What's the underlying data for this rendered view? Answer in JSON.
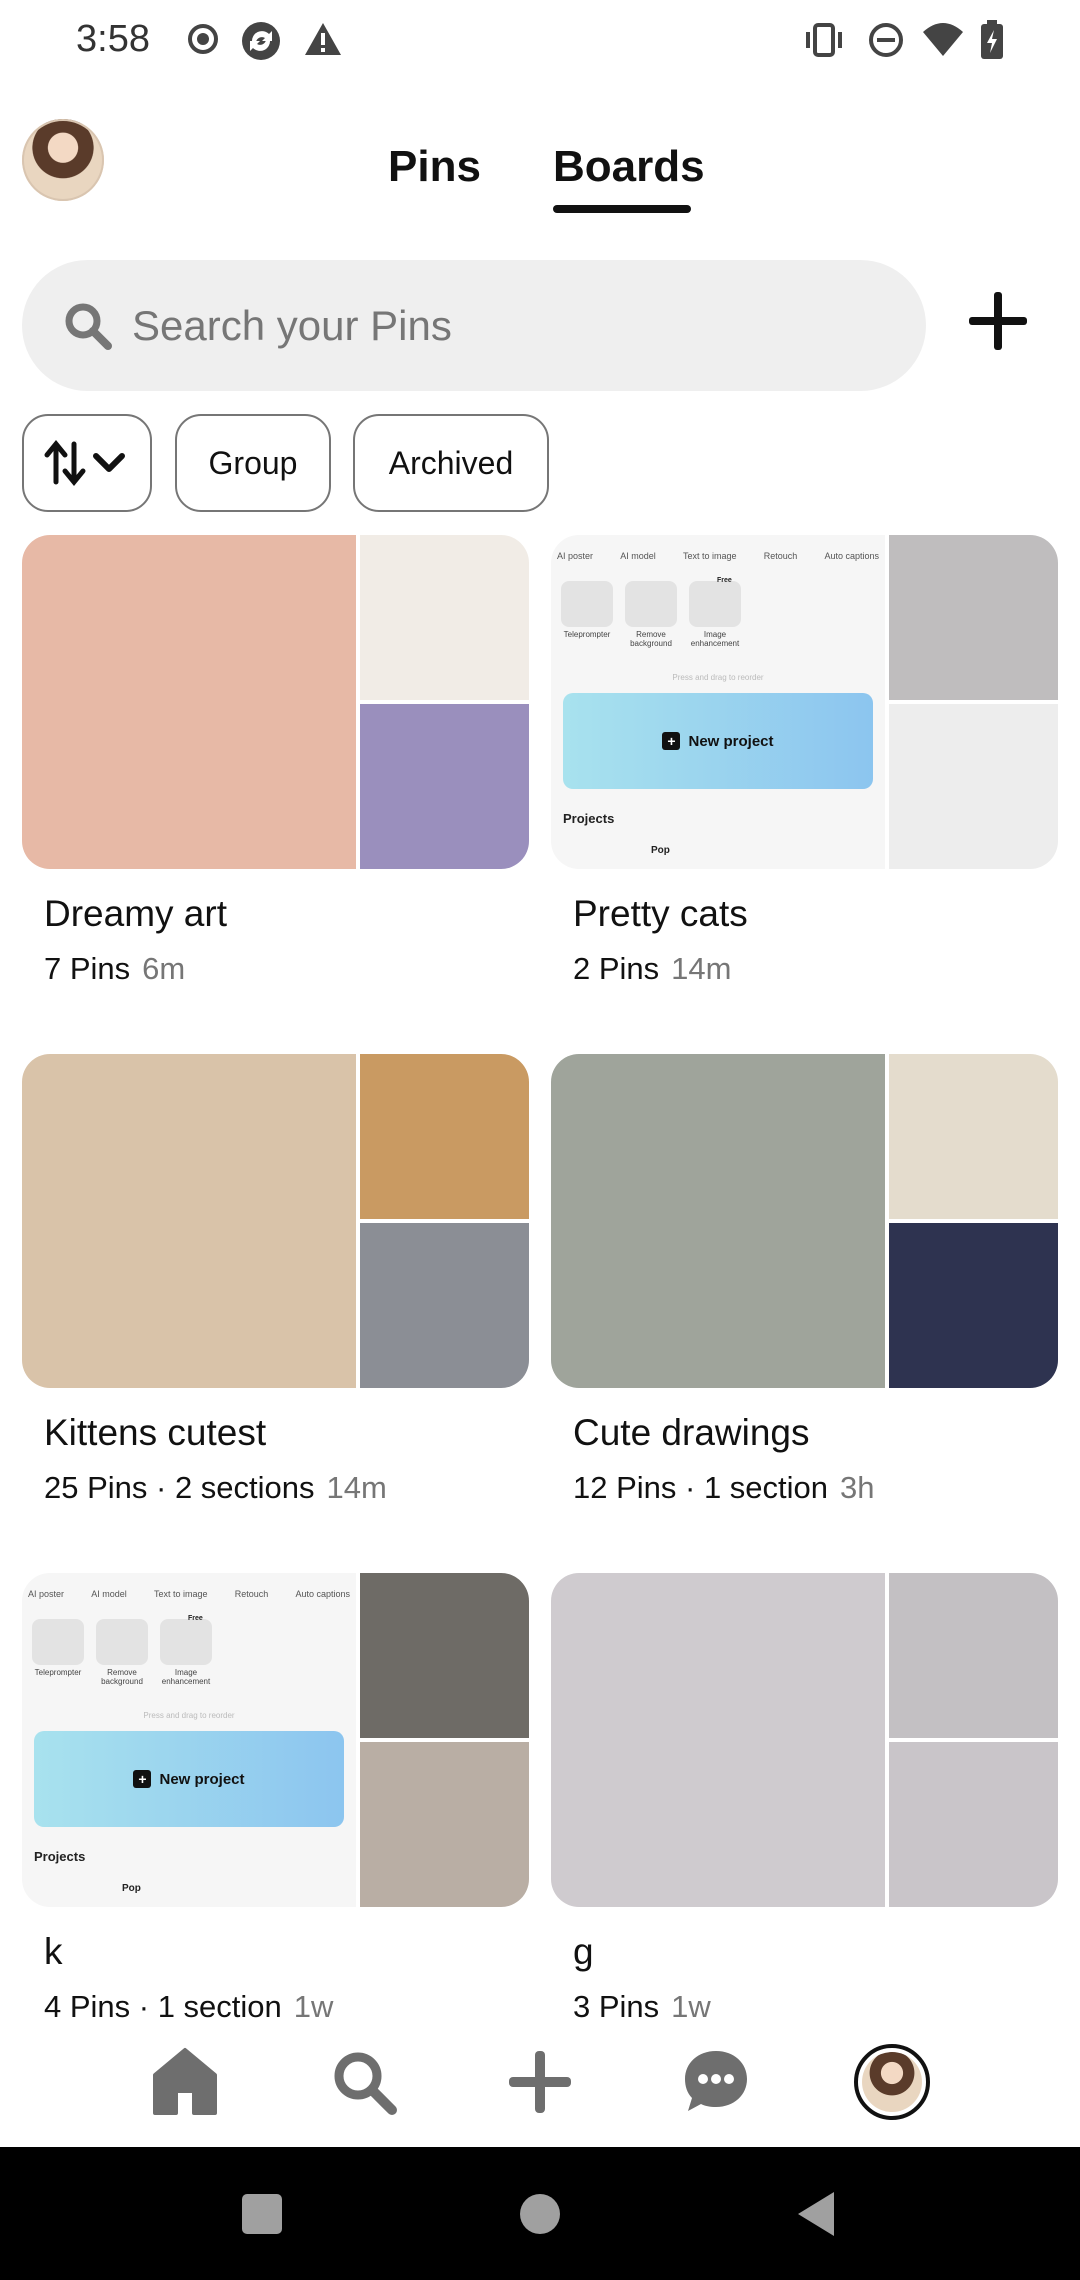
{
  "status_bar": {
    "time": "3:58",
    "left_icons": [
      "record-icon",
      "sync-app-icon",
      "warning-icon"
    ],
    "right_icons": [
      "vibrate-icon",
      "dnd-icon",
      "wifi-icon",
      "battery-charging-icon"
    ]
  },
  "header": {
    "tabs": [
      {
        "label": "Pins",
        "active": false
      },
      {
        "label": "Boards",
        "active": true
      }
    ]
  },
  "search": {
    "placeholder": "Search your Pins"
  },
  "filters": {
    "sort_icon": "sort-arrows-icon",
    "chips": [
      "Group",
      "Archived"
    ]
  },
  "boards": [
    {
      "title": "Dreamy art",
      "meta": "7 Pins",
      "time": "6m",
      "colors": [
        "#e7b9a6",
        "#f1ece6",
        "#9a8fbd"
      ]
    },
    {
      "title": "Pretty cats",
      "meta": "2 Pins",
      "time": "14m",
      "colors": [
        "#f6f6f6",
        "#bfbdbe",
        "#ededed"
      ]
    },
    {
      "title": "Kittens cutest",
      "meta": "25 Pins · 2 sections",
      "time": "14m",
      "colors": [
        "#d9c3a9",
        "#c99a62",
        "#8b8e95"
      ]
    },
    {
      "title": "Cute drawings",
      "meta": "12 Pins · 1 section",
      "time": "3h",
      "colors": [
        "#9fa49b",
        "#e4dccd",
        "#2e3350"
      ]
    },
    {
      "title": "k",
      "meta": "4 Pins · 1 section",
      "time": "1w",
      "colors": [
        "#f6f6f6",
        "#6e6b66",
        "#b9aea4"
      ]
    },
    {
      "title": "g",
      "meta": "3 Pins",
      "time": "1w",
      "colors": [
        "#cfcbcf",
        "#c3c0c3",
        "#c9c5c9"
      ]
    }
  ],
  "app_screenshot_tile": {
    "tools": [
      "AI poster",
      "AI model",
      "Text to image",
      "Retouch",
      "Auto captions"
    ],
    "features": [
      "Teleprompter",
      "Remove background",
      "Image enhancement"
    ],
    "badge": "Free",
    "hint": "Press and drag to reorder",
    "new_project": "New project",
    "projects": "Projects",
    "pop": "Pop"
  },
  "bottom_nav": [
    "home-icon",
    "search-icon",
    "create-icon",
    "messages-icon",
    "profile-avatar"
  ],
  "system_nav": [
    "recents-button",
    "home-button",
    "back-button"
  ]
}
